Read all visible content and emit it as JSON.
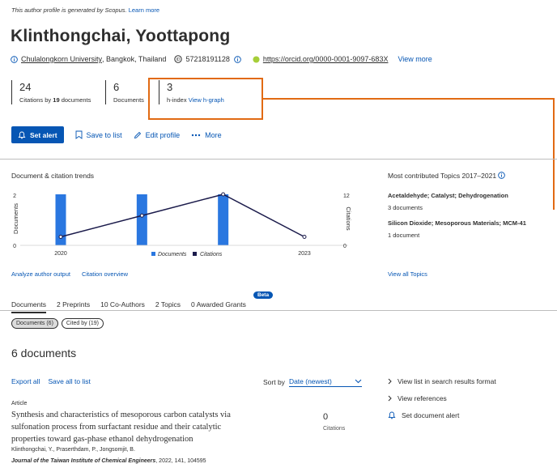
{
  "notice": {
    "text": "This author profile is generated by Scopus.",
    "link": "Learn more"
  },
  "author": {
    "name": "Klinthongchai, Yoottapong",
    "affiliation": "Chulalongkorn University",
    "location": ", Bangkok, Thailand",
    "scopus_id": "57218191128",
    "orcid": "https://orcid.org/0000-0001-9097-683X",
    "view_more": "View more"
  },
  "metrics": {
    "citations": {
      "value": "24",
      "label_prefix": "Citations by ",
      "label_count": "19",
      "label_suffix": " documents"
    },
    "documents": {
      "value": "6",
      "label": "Documents"
    },
    "hindex": {
      "value": "3",
      "label": "h-index",
      "link": "View h-graph"
    }
  },
  "actions": {
    "set_alert": "Set alert",
    "save_to_list": "Save to list",
    "edit_profile": "Edit profile",
    "more": "More"
  },
  "trends": {
    "title": "Document & citation trends",
    "links": [
      "Analyze author output",
      "Citation overview"
    ]
  },
  "chart_data": {
    "type": "bar",
    "title": "Document & citation trends",
    "x": [
      2020,
      2021,
      2022,
      2023
    ],
    "x_tick_labels": [
      "2020",
      "2023"
    ],
    "ylabel": "Documents",
    "ylim": [
      0,
      2
    ],
    "y_ticks": [
      "0",
      "2"
    ],
    "y2label": "Citations",
    "y2lim": [
      0,
      12
    ],
    "y2_ticks": [
      "0",
      "12"
    ],
    "series": [
      {
        "name": "Documents",
        "type": "bar",
        "color": "#2a77e0",
        "values": [
          2,
          2,
          2,
          0
        ]
      },
      {
        "name": "Citations",
        "type": "line",
        "color": "#1b1b4b",
        "values": [
          2,
          7,
          12,
          2
        ]
      }
    ],
    "legend": "bottom"
  },
  "topics": {
    "title": "Most contributed Topics 2017–2021",
    "items": [
      {
        "name": "Acetaldehyde; Catalyst; Dehydrogenation",
        "docs": "3 documents"
      },
      {
        "name": "Silicon Dioxide; Mesoporous Materials; MCM-41",
        "docs": "1 document"
      }
    ],
    "view_all": "View all Topics"
  },
  "tabs": [
    "Documents",
    "2 Preprints",
    "10 Co-Authors",
    "2 Topics",
    "0 Awarded Grants"
  ],
  "beta": "Beta",
  "chips": [
    "Documents (6)",
    "Cited by (19)"
  ],
  "documents": {
    "count_label": "6 documents",
    "export_all": "Export all",
    "save_all": "Save all to list",
    "sort_label": "Sort by",
    "sort_value": "Date (newest)",
    "side_links": [
      "View list in search results format",
      "View references",
      "Set document alert"
    ],
    "item": {
      "type": "Article",
      "title": "Synthesis and characteristics of mesoporous carbon catalysts via sulfonation process from surfactant residue and their catalytic properties toward gas-phase ethanol dehydrogenation",
      "authors": "Klinthongchai, Y., Praserthdam, P., Jongsomjit, B.",
      "journal": "Journal of the Taiwan Institute of Chemical Engineers",
      "journal_info": ", 2022, 141, 104595",
      "citations": "0",
      "citations_label": "Citations"
    }
  }
}
